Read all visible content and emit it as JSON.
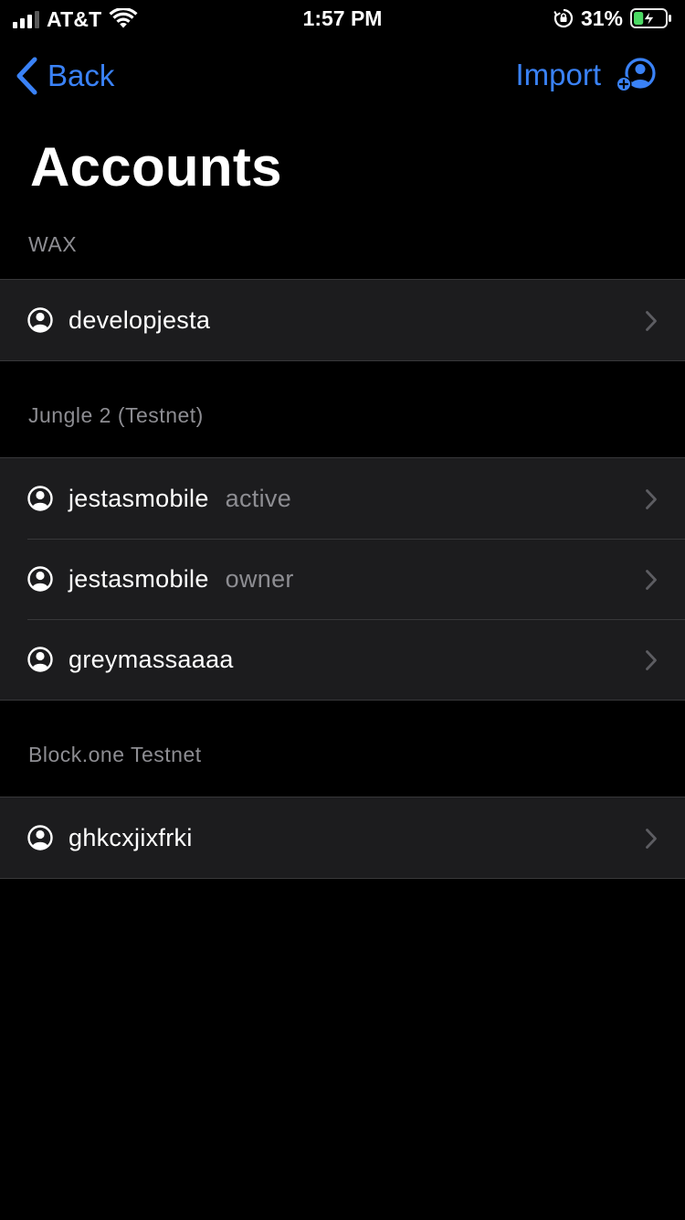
{
  "status_bar": {
    "carrier": "AT&T",
    "time": "1:57 PM",
    "battery_percent": "31%",
    "signal_bars_active": 3,
    "signal_bars_total": 4,
    "battery_level": 0.31,
    "battery_charging": true
  },
  "nav": {
    "back_label": "Back",
    "import_label": "Import",
    "accent_color": "#3a82f7"
  },
  "page": {
    "title": "Accounts"
  },
  "sections": [
    {
      "header": "WAX",
      "accounts": [
        {
          "name": "developjesta",
          "permission": ""
        }
      ]
    },
    {
      "header": "Jungle 2 (Testnet)",
      "accounts": [
        {
          "name": "jestasmobile",
          "permission": "active"
        },
        {
          "name": "jestasmobile",
          "permission": "owner"
        },
        {
          "name": "greymassaaaa",
          "permission": ""
        }
      ]
    },
    {
      "header": "Block.one Testnet",
      "accounts": [
        {
          "name": "ghkcxjixfrki",
          "permission": ""
        }
      ]
    }
  ],
  "icons": {
    "back": "chevron-left-icon",
    "import": "add-user-icon",
    "account": "user-circle-icon",
    "disclosure": "chevron-right-icon"
  }
}
